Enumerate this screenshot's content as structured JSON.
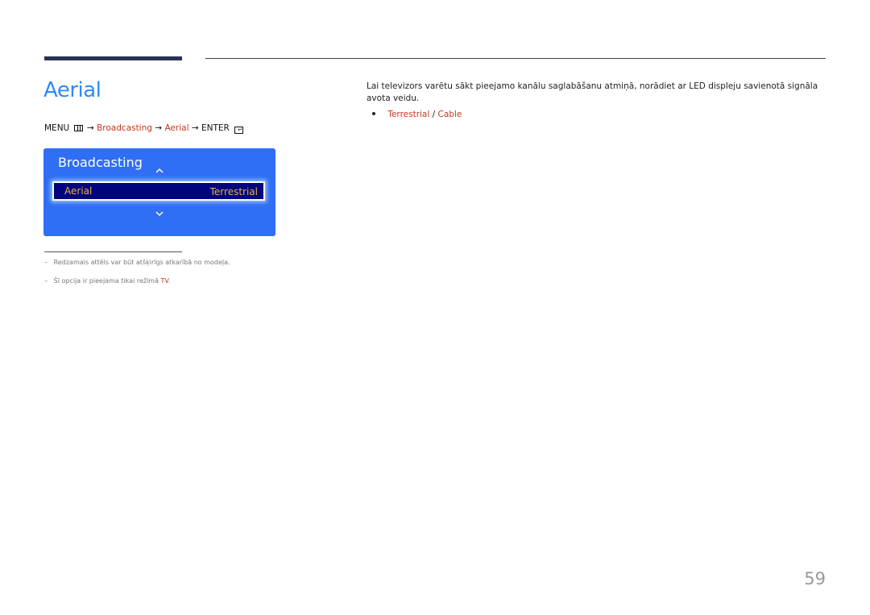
{
  "page": {
    "title": "Aerial",
    "page_number": "59"
  },
  "menu_path": {
    "menu": "MENU",
    "menu_icon": "menu-icon",
    "arrow": "→",
    "item1": "Broadcasting",
    "item2": "Aerial",
    "enter": "ENTER",
    "enter_icon": "enter-icon"
  },
  "osd_panel": {
    "title": "Broadcasting",
    "up_icon": "chevron-up-icon",
    "down_icon": "chevron-down-icon",
    "selected_item": {
      "label": "Aerial",
      "value": "Terrestrial"
    },
    "colors": {
      "panel_bg": "#2f6ef5",
      "row_bg": "#01047f",
      "text_highlight": "#e8b23a"
    }
  },
  "description": {
    "text": "Lai televizors varētu sākt pieejamo kanālu saglabāšanu atmiņā, norādiet ar LED displeju savienotā signāla avota veidu.",
    "options": [
      {
        "label": "Terrestrial"
      },
      {
        "label": "Cable"
      }
    ],
    "separator": " / "
  },
  "notes": [
    {
      "dash": "–",
      "text": "Redzamais attēls var būt atšķirīgs atkarībā no modeļa."
    },
    {
      "dash": "–",
      "text_before": "Šī opcija ir pieejama tikai režīmā ",
      "highlight": "TV",
      "text_after": "."
    }
  ],
  "colors": {
    "title": "#2b8cf7",
    "accent_red": "#c7371e",
    "header_bar": "#2b3150"
  }
}
